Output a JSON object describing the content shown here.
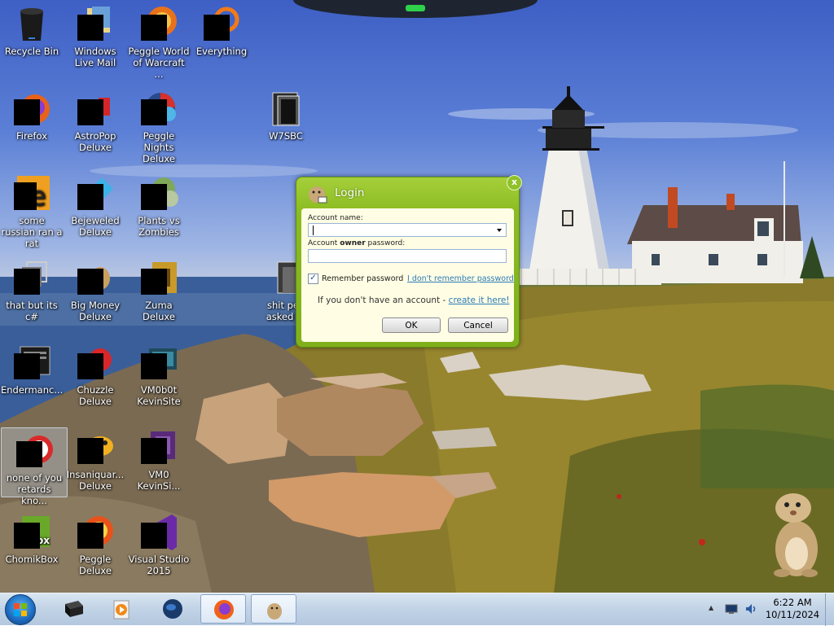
{
  "desktop": {
    "icons": [
      {
        "label": "Recycle Bin"
      },
      {
        "label": "Windows Live Mail"
      },
      {
        "label": "Peggle World of Warcraft ..."
      },
      {
        "label": "Everything"
      },
      {
        "label": "Firefox"
      },
      {
        "label": "AstroPop Deluxe"
      },
      {
        "label": "Peggle Nights Deluxe"
      },
      {
        "label": "W7SBC"
      },
      {
        "label": "some russian ran a rat"
      },
      {
        "label": "Bejeweled Deluxe"
      },
      {
        "label": "Plants vs Zombies"
      },
      {
        "label": "that but its c#"
      },
      {
        "label": "Big Money Deluxe"
      },
      {
        "label": "Zuma Deluxe"
      },
      {
        "label": "shit peo asked m"
      },
      {
        "label": "Endermanc..."
      },
      {
        "label": "Chuzzle Deluxe"
      },
      {
        "label": "VM0b0t KevinSite"
      },
      {
        "label": "none of you retards kno..."
      },
      {
        "label": "Insaniquar... Deluxe"
      },
      {
        "label": "VM0 KevinSi..."
      },
      {
        "label": "ChomikBox"
      },
      {
        "label": "Peggle Deluxe"
      },
      {
        "label": "Visual Studio 2015"
      }
    ]
  },
  "dialog": {
    "title": "Login",
    "close_glyph": "x",
    "account_name_label": "Account name:",
    "account_name_value": "",
    "password_label_pre": "Account ",
    "password_label_bold": "owner",
    "password_label_post": " password:",
    "password_value": "",
    "remember_label": "Remember password",
    "remember_checked": true,
    "check_glyph": "✓",
    "forgot_link": "I don't remember password",
    "signup_text": "If you don't have an account - ",
    "signup_link": "create it here!",
    "ok_label": "OK",
    "cancel_label": "Cancel"
  },
  "taskbar": {
    "items": [
      {
        "icon": "terminal-icon"
      },
      {
        "icon": "media-player-icon"
      },
      {
        "icon": "globe-icon"
      },
      {
        "icon": "firefox-icon",
        "active": true
      },
      {
        "icon": "hamster-icon",
        "active": true
      }
    ],
    "tray_up_glyph": "▲",
    "clock_time": "6:22 AM",
    "clock_date": "10/11/2024"
  }
}
